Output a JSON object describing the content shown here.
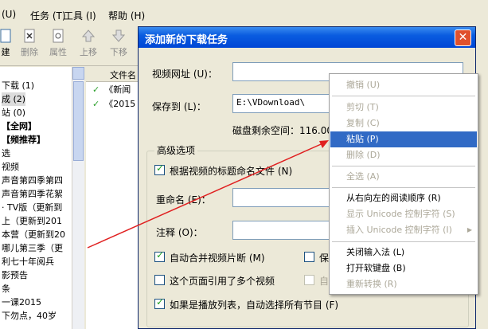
{
  "menubar": {
    "items": [
      "(U)",
      "任务 (T)",
      "工具 (I)",
      "帮助 (H)"
    ]
  },
  "toolbar": {
    "buttons": [
      {
        "label": "建",
        "icon": "new-icon"
      },
      {
        "label": "删除",
        "icon": "delete-icon"
      },
      {
        "label": "属性",
        "icon": "properties-icon"
      },
      {
        "label": "上移",
        "icon": "move-up-icon"
      },
      {
        "label": "下移",
        "icon": "move-down-icon"
      }
    ]
  },
  "categories": [
    "下载 (1)",
    "成 (2)",
    "站 (0)",
    "【全网】",
    "【频推荐】",
    "选",
    "视频",
    "声音第四季第四",
    "声音第四季花絮",
    "· TV版（更新到",
    "上（更新到201",
    "本营（更新到20",
    "哪儿第三季（更",
    "利七十年阅兵",
    "影预告",
    "条",
    "一课2015",
    "下勿点，40岁"
  ],
  "list": {
    "header": "文件名",
    "rows": [
      "《新闻",
      "《2015"
    ]
  },
  "dialog": {
    "title": "添加新的下载任务",
    "url_label": "视频网址 (U)：",
    "url_value": "",
    "save_label": "保存到 (L)：",
    "save_value": "E:\\VDownload\\",
    "disk_space_label": "磁盘剩余空间：116.00",
    "advanced_title": "高级选项",
    "rename_by_title": "根据视频的标题命名文件 (N)",
    "rename_label": "重命名 (E)：",
    "comment_label": "注释 (O)：",
    "auto_merge": "自动合并视频片断 (M)",
    "partial_save": "保",
    "multi_video": "这个页面引用了多个视频",
    "partial_auto": "自",
    "playlist": "如果是播放列表，自动选择所有节目 (F)",
    "close": "✕"
  },
  "context_menu": {
    "items": [
      {
        "label": "撤销 (U)",
        "state": "disabled"
      },
      {
        "sep": true
      },
      {
        "label": "剪切 (T)",
        "state": "disabled"
      },
      {
        "label": "复制 (C)",
        "state": "disabled"
      },
      {
        "label": "粘贴 (P)",
        "state": "highlighted"
      },
      {
        "label": "删除 (D)",
        "state": "disabled"
      },
      {
        "sep": true
      },
      {
        "label": "全选 (A)",
        "state": "disabled"
      },
      {
        "sep": true
      },
      {
        "label": "从右向左的阅读顺序 (R)",
        "state": "enabled"
      },
      {
        "label": "显示 Unicode 控制字符 (S)",
        "state": "disabled"
      },
      {
        "label": "插入 Unicode 控制字符 (I)",
        "state": "disabled",
        "submenu": true
      },
      {
        "sep": true
      },
      {
        "label": "关闭输入法 (L)",
        "state": "enabled"
      },
      {
        "label": "打开软键盘 (B)",
        "state": "enabled"
      },
      {
        "label": "重新转换 (R)",
        "state": "disabled"
      }
    ]
  },
  "colors": {
    "highlight": "#316ac5",
    "titlebar": "#0046d5",
    "annotation_arrow": "#e02020"
  }
}
